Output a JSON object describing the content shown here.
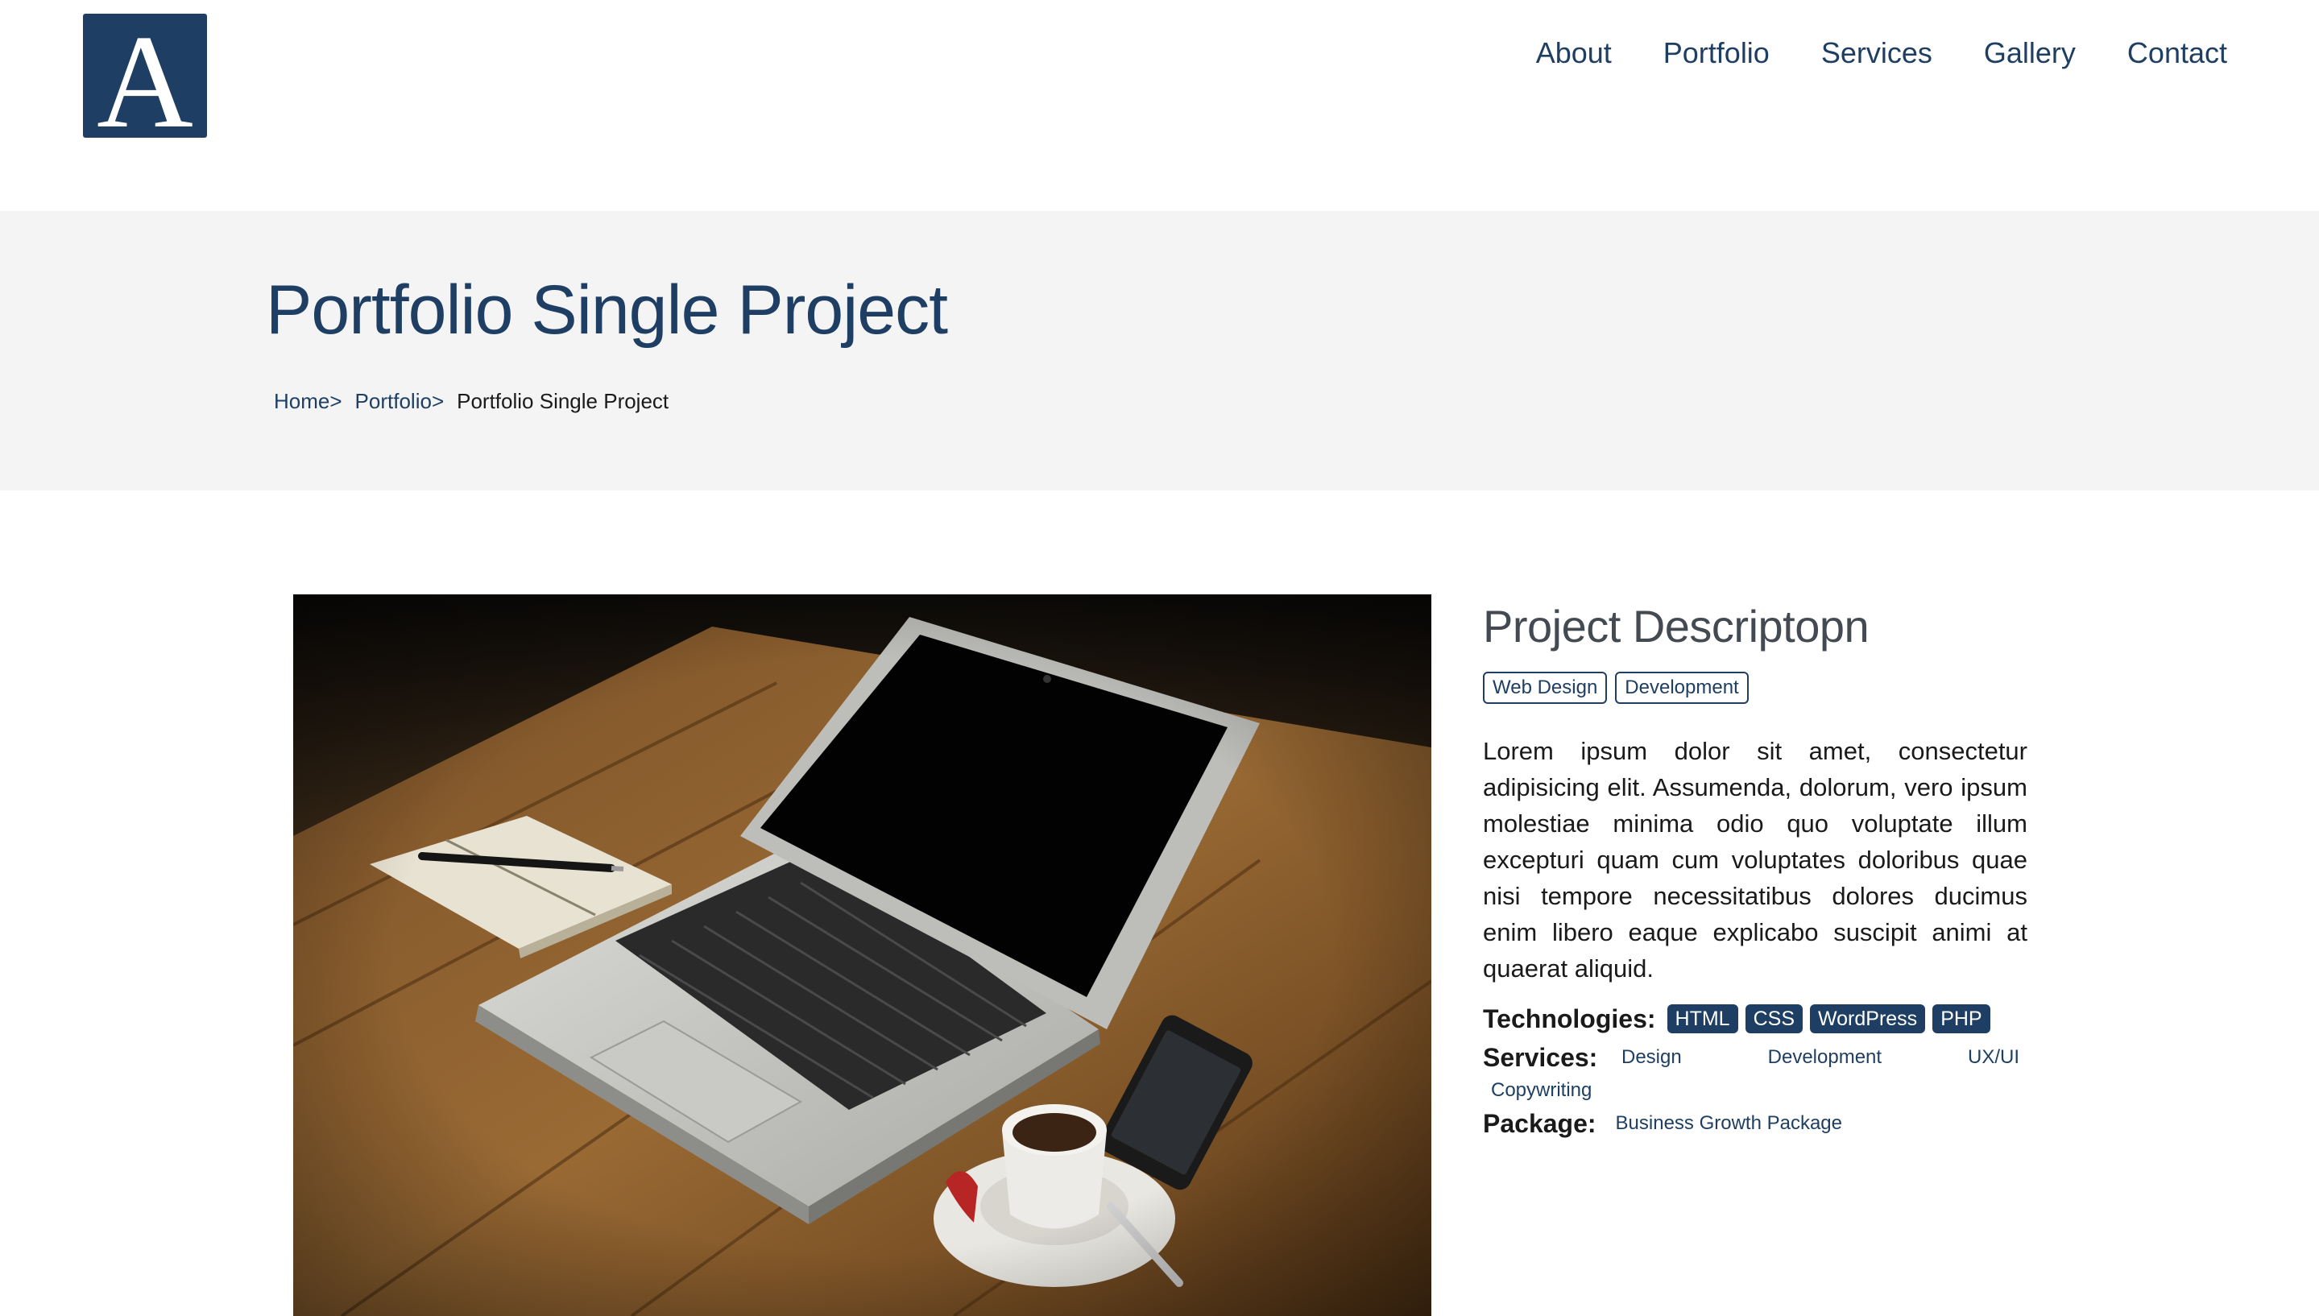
{
  "logo": {
    "letter": "A"
  },
  "nav": [
    "About",
    "Portfolio",
    "Services",
    "Gallery",
    "Contact"
  ],
  "title_band": {
    "title": "Portfolio Single Project",
    "breadcrumb": {
      "home": "Home",
      "portfolio": "Portfolio",
      "separator": ">",
      "current": "Portfolio Single Project"
    }
  },
  "project": {
    "heading": "Project Descriptopn",
    "categories": [
      "Web Design",
      "Development"
    ],
    "description": "Lorem ipsum dolor sit amet, consectetur adipisicing elit. Assumenda, dolorum, vero ipsum molestiae minima odio quo voluptate illum excepturi quam cum voluptates doloribus quae nisi tempore necessitatibus dolores ducimus enim libero eaque explicabo suscipit animi at quaerat aliquid.",
    "technologies_label": "Technologies:",
    "technologies": [
      "HTML",
      "CSS",
      "WordPress",
      "PHP"
    ],
    "services_label": "Services:",
    "services": [
      "Design",
      "Development",
      "UX/UI",
      "Copywriting"
    ],
    "package_label": "Package:",
    "package": "Business Growth Package"
  },
  "colors": {
    "brand": "#1e3f63",
    "band_bg": "#f4f4f4",
    "heading_gray": "#444a52"
  }
}
